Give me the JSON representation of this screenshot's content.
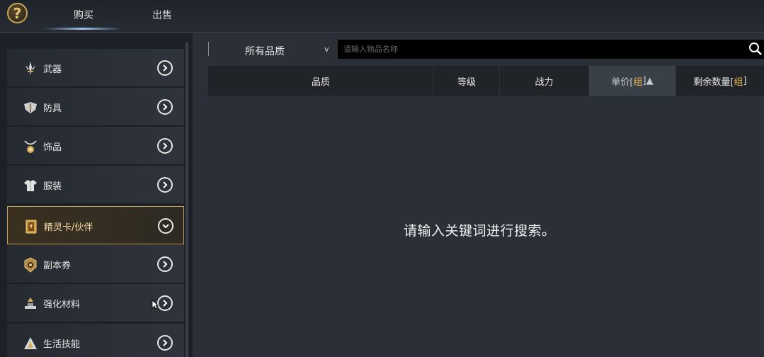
{
  "header": {
    "help_icon": "question-mark-icon",
    "help_glyph": "?",
    "tabs": [
      {
        "label": "购买",
        "active": true
      },
      {
        "label": "出售",
        "active": false
      }
    ]
  },
  "sidebar": {
    "items": [
      {
        "label": "武器",
        "icon": "weapon-icon"
      },
      {
        "label": "防具",
        "icon": "armor-icon"
      },
      {
        "label": "饰品",
        "icon": "accessory-icon"
      },
      {
        "label": "服装",
        "icon": "costume-icon"
      },
      {
        "label": "精灵卡/伙伴",
        "icon": "spirit-card-icon",
        "active": true
      },
      {
        "label": "副本券",
        "icon": "dungeon-ticket-icon"
      },
      {
        "label": "强化材料",
        "icon": "enhance-material-icon"
      },
      {
        "label": "生活技能",
        "icon": "life-skill-icon"
      }
    ]
  },
  "filter": {
    "quality_selected": "所有品质",
    "caret": "v",
    "search_placeholder": "请输入物品名称"
  },
  "table": {
    "columns": {
      "quality": "品质",
      "level": "等级",
      "power": "战力",
      "unit_price_prefix": "单价[",
      "unit_price_unit": "组",
      "unit_price_suffix": "]▲",
      "remaining_prefix": "剩余数量[",
      "remaining_unit": "组",
      "remaining_suffix": "]"
    }
  },
  "main": {
    "empty_message": "请输入关键词进行搜索。"
  },
  "colors": {
    "accent_gold": "#e2b24a",
    "active_border": "#c9a35c",
    "tab_underline": "#9fc4ee"
  }
}
